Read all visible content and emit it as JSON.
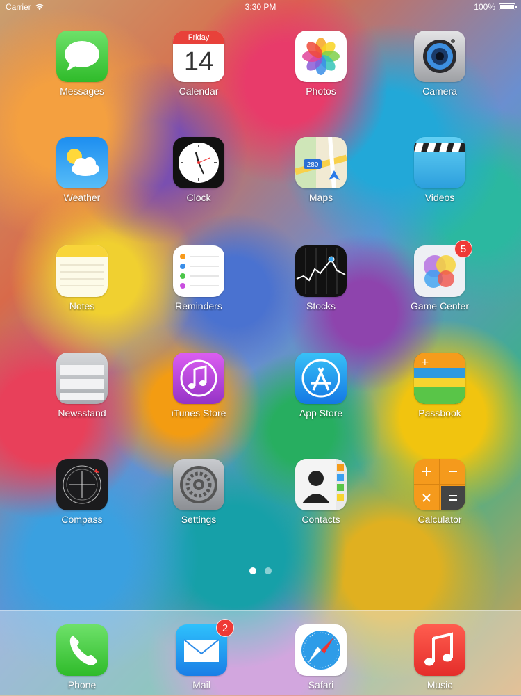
{
  "status_bar": {
    "carrier": "Carrier",
    "time": "3:30 PM",
    "battery_percent": "100%",
    "battery_level": 1.0
  },
  "calendar_icon": {
    "day": "Friday",
    "date": "14"
  },
  "maps_icon": {
    "route_label": "280"
  },
  "apps": {
    "messages": {
      "label": "Messages",
      "icon": "speech-bubble-icon"
    },
    "calendar": {
      "label": "Calendar",
      "icon": "calendar-icon"
    },
    "photos": {
      "label": "Photos",
      "icon": "pinwheel-icon"
    },
    "camera": {
      "label": "Camera",
      "icon": "lens-icon"
    },
    "weather": {
      "label": "Weather",
      "icon": "sun-cloud-icon"
    },
    "clock": {
      "label": "Clock",
      "icon": "clock-face-icon"
    },
    "maps": {
      "label": "Maps",
      "icon": "map-icon"
    },
    "videos": {
      "label": "Videos",
      "icon": "clapperboard-icon"
    },
    "notes": {
      "label": "Notes",
      "icon": "notepad-icon"
    },
    "reminders": {
      "label": "Reminders",
      "icon": "checklist-icon"
    },
    "stocks": {
      "label": "Stocks",
      "icon": "stock-chart-icon"
    },
    "game_center": {
      "label": "Game Center",
      "icon": "bubbles-icon",
      "badge": "5"
    },
    "newsstand": {
      "label": "Newsstand",
      "icon": "shelf-icon"
    },
    "itunes_store": {
      "label": "iTunes Store",
      "icon": "music-note-icon"
    },
    "app_store": {
      "label": "App Store",
      "icon": "app-store-a-icon"
    },
    "passbook": {
      "label": "Passbook",
      "icon": "tickets-icon"
    },
    "compass": {
      "label": "Compass",
      "icon": "compass-icon"
    },
    "settings": {
      "label": "Settings",
      "icon": "gear-icon"
    },
    "contacts": {
      "label": "Contacts",
      "icon": "person-silhouette-icon"
    },
    "calculator": {
      "label": "Calculator",
      "icon": "calculator-icon"
    }
  },
  "dock": {
    "phone": {
      "label": "Phone",
      "icon": "phone-handset-icon"
    },
    "mail": {
      "label": "Mail",
      "icon": "envelope-icon",
      "badge": "2"
    },
    "safari": {
      "label": "Safari",
      "icon": "compass-needle-icon"
    },
    "music": {
      "label": "Music",
      "icon": "music-note-icon"
    }
  },
  "page_indicator": {
    "pages": 2,
    "current": 1
  },
  "colors": {
    "badge_red": "#ef3a36",
    "label_white": "#ffffff"
  }
}
